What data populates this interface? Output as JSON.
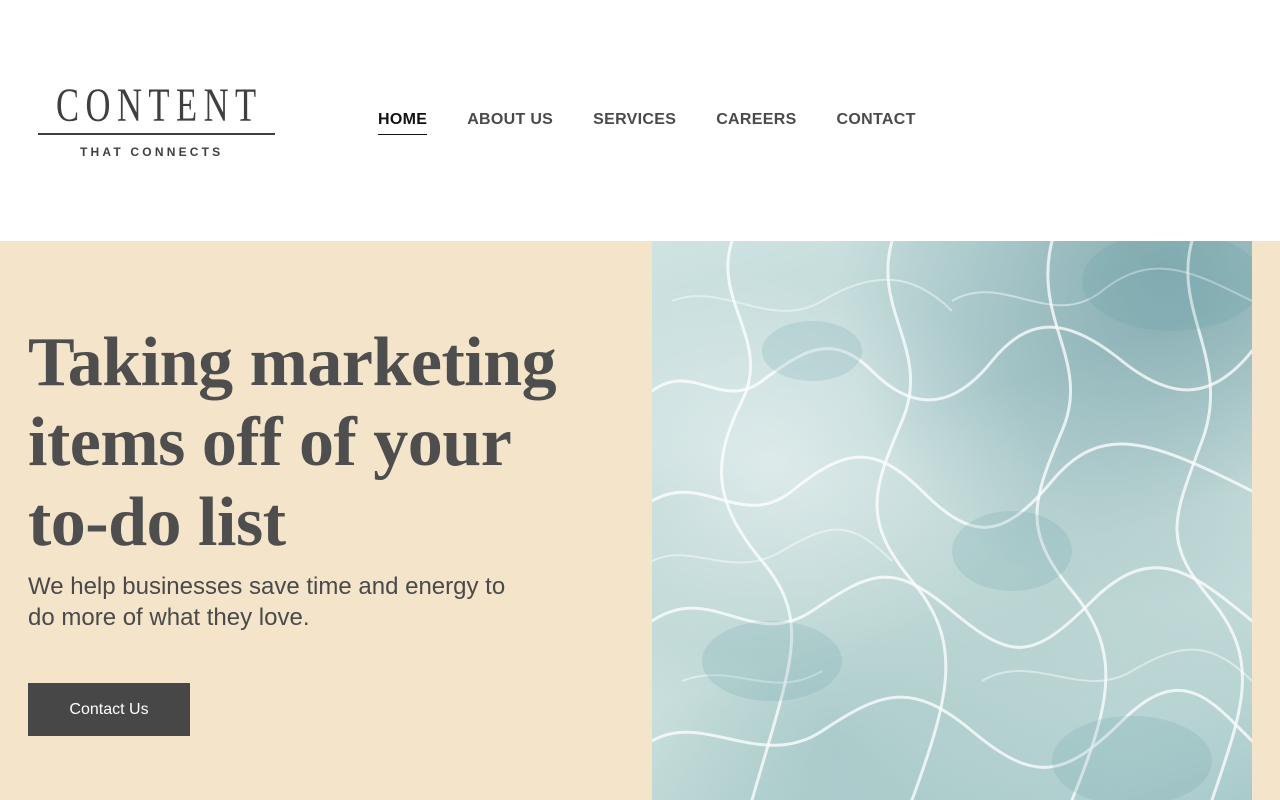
{
  "logo": {
    "wordmark": "CONTENT",
    "tagline": "THAT CONNECTS"
  },
  "nav": {
    "items": [
      {
        "label": "HOME",
        "active": true
      },
      {
        "label": "ABOUT US",
        "active": false
      },
      {
        "label": "SERVICES",
        "active": false
      },
      {
        "label": "CAREERS",
        "active": false
      },
      {
        "label": "CONTACT",
        "active": false
      }
    ]
  },
  "hero": {
    "title": "Taking marketing items off of your to-do list",
    "subtitle": "We help businesses save time and energy to do more of what they love.",
    "cta_label": "Contact Us",
    "image_description_icon": "water-ripple-image"
  },
  "colors": {
    "hero_background": "#f4e4ca",
    "button_background": "#474747",
    "text": "#4a4a4a",
    "nav_active": "#111111"
  }
}
